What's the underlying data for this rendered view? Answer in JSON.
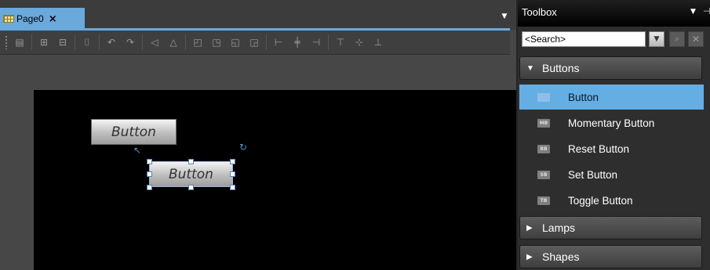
{
  "editor": {
    "tab_label": "Page0",
    "tab_close": "×",
    "tab_dropdown": "▼",
    "toolbar_icons": [
      "properties-icon",
      "align-group-icon",
      "ungroup-icon",
      "shape-edit-icon",
      "rotate-left-icon",
      "rotate-right-icon",
      "flip-horizontal-icon",
      "flip-vertical-icon",
      "bring-forward-icon",
      "send-backward-icon",
      "bring-to-front-icon",
      "send-to-back-icon",
      "align-left-icon",
      "align-center-icon",
      "align-right-icon",
      "align-top-icon",
      "align-middle-icon",
      "align-bottom-icon"
    ],
    "canvas": {
      "background": "#000000",
      "buttons": [
        {
          "label": "Button"
        },
        {
          "label": "Button"
        }
      ]
    }
  },
  "toolbox": {
    "title": "Toolbox",
    "menu_glyph": "▼",
    "pin_glyph": "⊣",
    "search": {
      "value": "<Search>",
      "dropdown_glyph": "▼",
      "search_glyph": "⌕",
      "clear_glyph": "✕"
    },
    "categories": [
      {
        "label": "Buttons",
        "expanded": true
      },
      {
        "label": "Lamps",
        "expanded": false
      },
      {
        "label": "Shapes",
        "expanded": false
      }
    ],
    "items": [
      {
        "label": "Button",
        "icon": "B",
        "selected": true
      },
      {
        "label": "Momentary Button",
        "icon": "MB",
        "selected": false
      },
      {
        "label": "Reset Button",
        "icon": "RB",
        "selected": false
      },
      {
        "label": "Set Button",
        "icon": "SB",
        "selected": false
      },
      {
        "label": "Toggle Button",
        "icon": "TB",
        "selected": false
      }
    ],
    "accent_color": "#65aee4"
  }
}
